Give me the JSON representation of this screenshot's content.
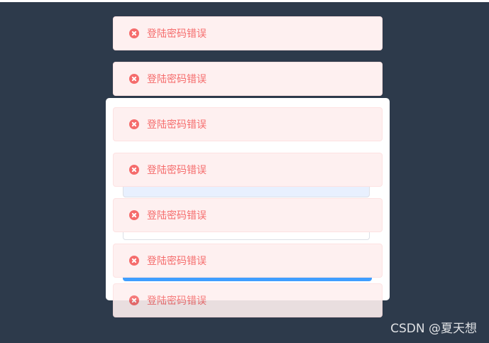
{
  "login": {
    "username_value": "",
    "password_value": "",
    "button_label": ""
  },
  "toasts": [
    {
      "message": "登陆密码错误"
    },
    {
      "message": "登陆密码错误"
    },
    {
      "message": "登陆密码错误"
    },
    {
      "message": "登陆密码错误"
    },
    {
      "message": "登陆密码错误"
    },
    {
      "message": "登陆密码错误"
    },
    {
      "message": "登陆密码错误"
    }
  ],
  "icons": {
    "toast_icon": "error-circle-icon"
  },
  "colors": {
    "background": "#2d3a4b",
    "toast_background": "#fef0f0",
    "toast_text": "#f56c6c",
    "button": "#409eff"
  },
  "watermark": "CSDN @夏天想"
}
